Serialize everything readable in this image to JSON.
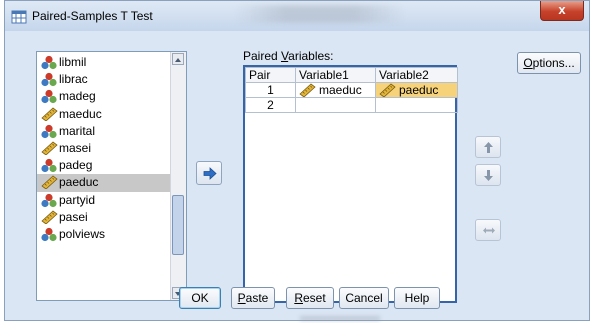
{
  "window": {
    "title": "Paired-Samples T Test",
    "close_glyph": "x"
  },
  "variables": [
    {
      "name": "libmil",
      "kind": "nominal",
      "selected": false
    },
    {
      "name": "librac",
      "kind": "nominal",
      "selected": false
    },
    {
      "name": "madeg",
      "kind": "nominal",
      "selected": false
    },
    {
      "name": "maeduc",
      "kind": "scale",
      "selected": false
    },
    {
      "name": "marital",
      "kind": "nominal",
      "selected": false
    },
    {
      "name": "masei",
      "kind": "scale",
      "selected": false
    },
    {
      "name": "padeg",
      "kind": "nominal",
      "selected": false
    },
    {
      "name": "paeduc",
      "kind": "scale",
      "selected": true
    },
    {
      "name": "partyid",
      "kind": "nominal",
      "selected": false
    },
    {
      "name": "pasei",
      "kind": "scale",
      "selected": false
    },
    {
      "name": "polviews",
      "kind": "nominal",
      "selected": false
    }
  ],
  "paired": {
    "label_prefix": "Paired ",
    "label_mnemonic": "V",
    "label_rest": "ariables:",
    "headers": [
      "Pair",
      "Variable1",
      "Variable2"
    ],
    "rows": [
      {
        "pair": "1",
        "var1": "maeduc",
        "var2": "paeduc"
      },
      {
        "pair": "2",
        "var1": "",
        "var2": ""
      }
    ]
  },
  "buttons": {
    "options_pre": "",
    "options_mn": "O",
    "options_post": "ptions...",
    "ok": "OK",
    "paste_mn": "P",
    "paste_post": "aste",
    "reset_mn": "R",
    "reset_post": "eset",
    "cancel": "Cancel",
    "help": "Help"
  },
  "colors": {
    "nominal_icon": [
      "#cc3b2a",
      "#3d7ac2",
      "#6aa84f"
    ],
    "scale_icon": "#e0b43a",
    "selected_cell": "#f6d27a",
    "accent_arrow": "#2e6fc5"
  }
}
